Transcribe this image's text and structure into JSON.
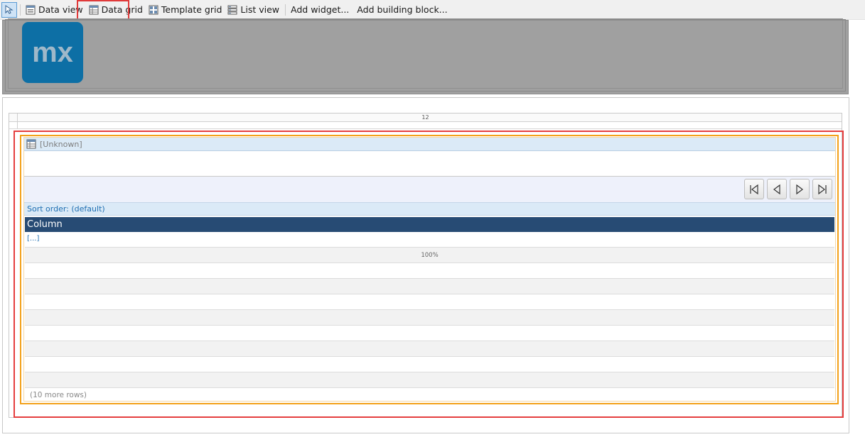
{
  "toolbar": {
    "pointer_icon": "pointer-select-icon",
    "items": [
      {
        "label": "Data view",
        "icon": "data-view-icon"
      },
      {
        "label": "Data grid",
        "icon": "data-grid-icon"
      },
      {
        "label": "Template grid",
        "icon": "template-grid-icon"
      },
      {
        "label": "List view",
        "icon": "list-view-icon"
      },
      {
        "label": "Add widget..."
      },
      {
        "label": "Add building block..."
      }
    ]
  },
  "header": {
    "logo_text": "mx",
    "logo_color": "#0d6fa5"
  },
  "layout": {
    "column_span": "12"
  },
  "data_grid": {
    "title": "[Unknown]",
    "paging": [
      "first-page-icon",
      "previous-page-icon",
      "next-page-icon",
      "last-page-icon"
    ],
    "sort_order": "Sort order: (default)",
    "column_header": "Column",
    "column_cell": "[...]",
    "column_width": "100%",
    "more_rows": "(10 more rows)"
  },
  "colors": {
    "selection_red": "#e53e3e",
    "selection_orange": "#f3a11a",
    "column_header_bg": "#274b74"
  }
}
